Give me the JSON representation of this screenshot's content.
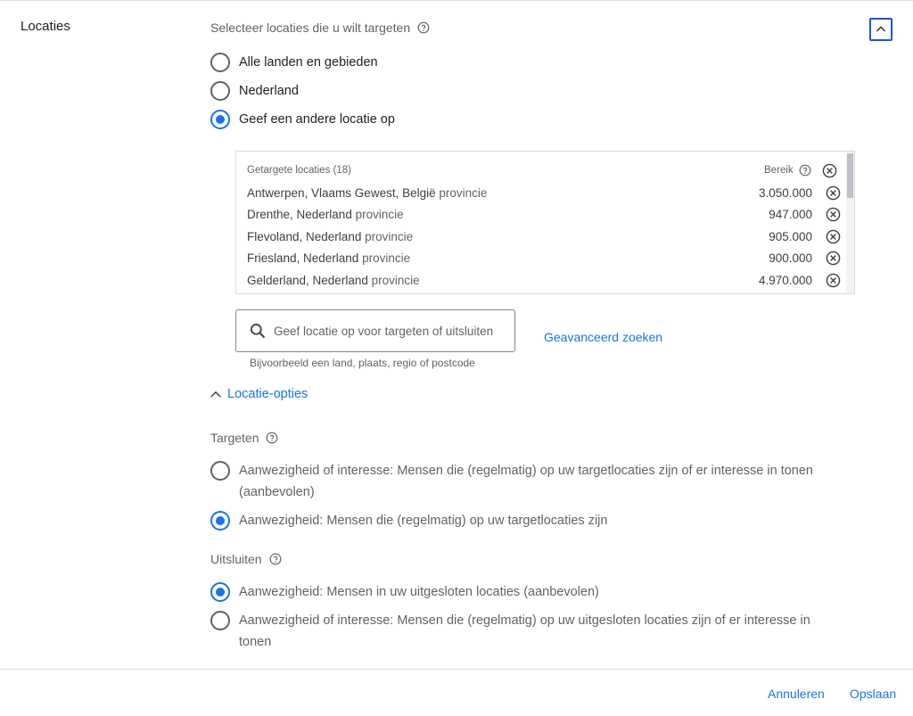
{
  "section": {
    "label": "Locaties"
  },
  "prompt": {
    "text": "Selecteer locaties die u wilt targeten"
  },
  "location_choices": [
    {
      "label": "Alle landen en gebieden",
      "checked": false
    },
    {
      "label": "Nederland",
      "checked": false
    },
    {
      "label": "Geef een andere locatie op",
      "checked": true
    }
  ],
  "targets": {
    "header": "Getargete locaties (18)",
    "reach_header": "Bereik",
    "rows": [
      {
        "location": "Antwerpen, Vlaams Gewest, België",
        "type": "provincie",
        "reach": "3.050.000"
      },
      {
        "location": "Drenthe, Nederland",
        "type": "provincie",
        "reach": "947.000"
      },
      {
        "location": "Flevoland, Nederland",
        "type": "provincie",
        "reach": "905.000"
      },
      {
        "location": "Friesland, Nederland",
        "type": "provincie",
        "reach": "900.000"
      },
      {
        "location": "Gelderland, Nederland",
        "type": "provincie",
        "reach": "4.970.000"
      }
    ]
  },
  "search": {
    "placeholder": "Geef locatie op voor targeten of uitsluiten",
    "value": "",
    "hint": "Bijvoorbeeld een land, plaats, regio of postcode"
  },
  "advanced_search": "Geavanceerd zoeken",
  "location_options": "Locatie-opties",
  "targeting": {
    "label": "Targeten",
    "options": [
      {
        "line1": "Aanwezigheid of interesse: Mensen die (regelmatig) op uw targetlocaties zijn of er interesse in tonen",
        "line2": "(aanbevolen)",
        "checked": false
      },
      {
        "line1": "Aanwezigheid: Mensen die (regelmatig) op uw targetlocaties zijn",
        "line2": "",
        "checked": true
      }
    ]
  },
  "exclude": {
    "label": "Uitsluiten",
    "options": [
      {
        "line1": "Aanwezigheid: Mensen in uw uitgesloten locaties (aanbevolen)",
        "line2": "",
        "checked": true
      },
      {
        "line1": "Aanwezigheid of interesse: Mensen die (regelmatig) op uw uitgesloten locaties zijn of er interesse in",
        "line2": "tonen",
        "checked": false
      }
    ]
  },
  "footer": {
    "cancel": "Annuleren",
    "save": "Opslaan"
  },
  "colors": {
    "accent": "#1a73e8",
    "text": "#202124",
    "muted": "#5f6368"
  }
}
